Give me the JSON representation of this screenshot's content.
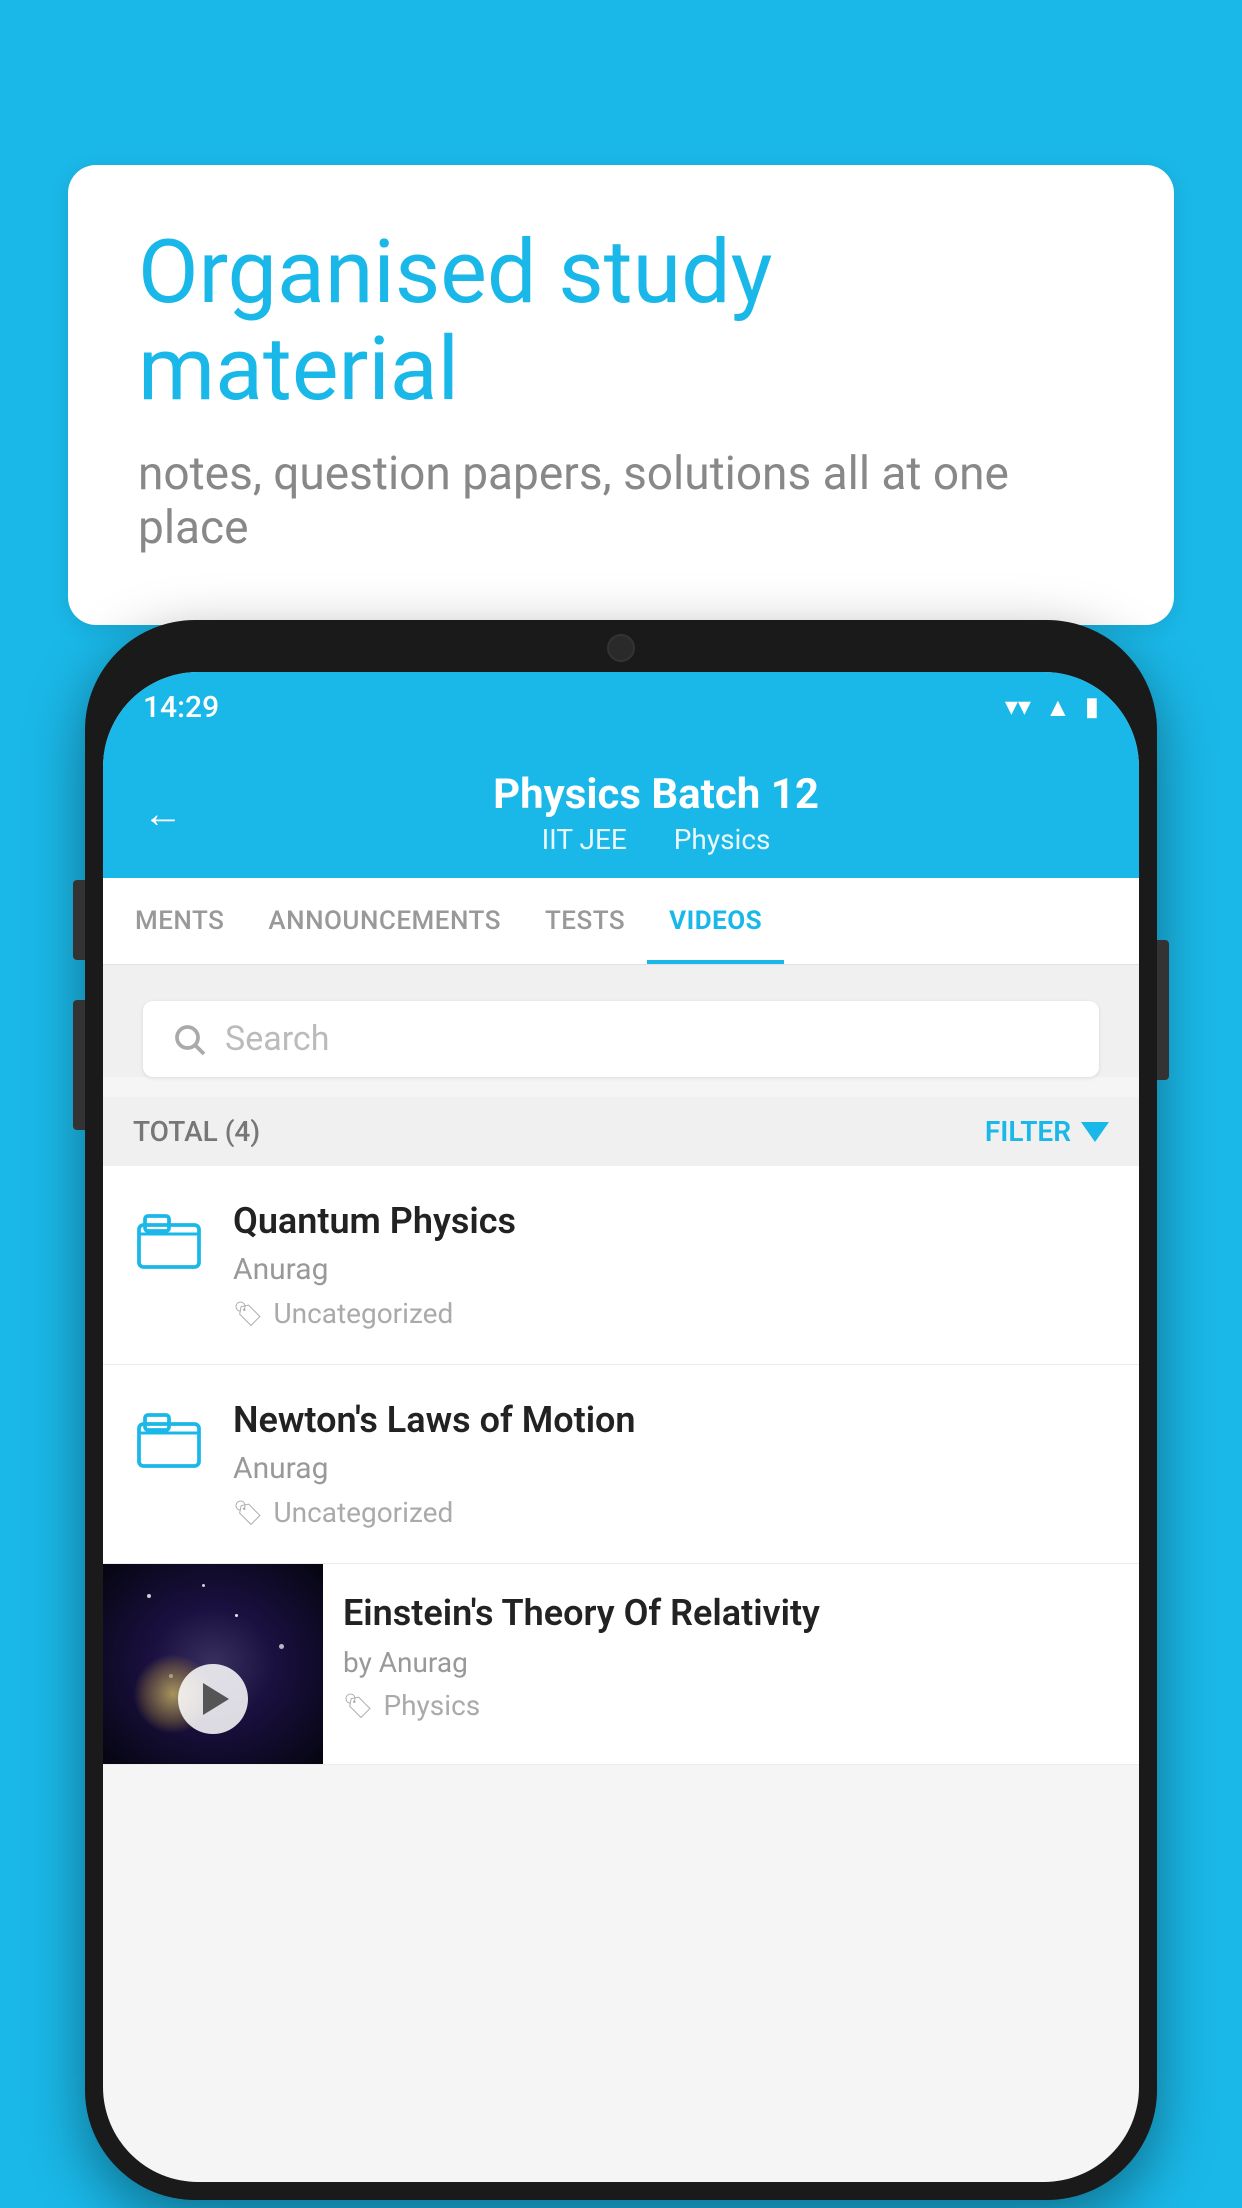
{
  "background_color": "#1ab8e8",
  "bubble": {
    "title": "Organised study material",
    "subtitle": "notes, question papers, solutions all at one place"
  },
  "phone": {
    "status_bar": {
      "time": "14:29",
      "icons": [
        "wifi",
        "signal",
        "battery"
      ]
    },
    "header": {
      "back_label": "←",
      "title": "Physics Batch 12",
      "subtitle_part1": "IIT JEE",
      "subtitle_part2": "Physics"
    },
    "tabs": [
      {
        "label": "MENTS",
        "active": false
      },
      {
        "label": "ANNOUNCEMENTS",
        "active": false
      },
      {
        "label": "TESTS",
        "active": false
      },
      {
        "label": "VIDEOS",
        "active": true
      }
    ],
    "search": {
      "placeholder": "Search"
    },
    "filter_bar": {
      "total_label": "TOTAL (4)",
      "filter_label": "FILTER"
    },
    "videos": [
      {
        "title": "Quantum Physics",
        "author": "Anurag",
        "tag": "Uncategorized",
        "has_thumbnail": false
      },
      {
        "title": "Newton's Laws of Motion",
        "author": "Anurag",
        "tag": "Uncategorized",
        "has_thumbnail": false
      },
      {
        "title": "Einstein's Theory Of Relativity",
        "author": "by Anurag",
        "tag": "Physics",
        "has_thumbnail": true
      }
    ]
  }
}
